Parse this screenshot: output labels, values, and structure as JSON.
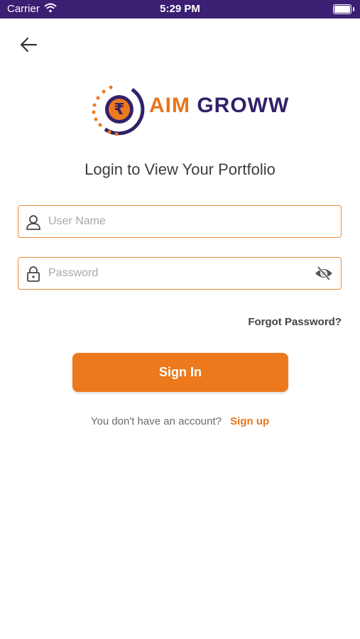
{
  "status_bar": {
    "carrier": "Carrier",
    "time": "5:29 PM"
  },
  "logo": {
    "word1": "AIM",
    "word2": "GROWW"
  },
  "title": "Login to View Your Portfolio",
  "username": {
    "placeholder": "User Name",
    "value": ""
  },
  "password": {
    "placeholder": "Password",
    "value": ""
  },
  "forgot_password": "Forgot Password?",
  "signin_button": "Sign In",
  "signup": {
    "question": "You don't have an account?",
    "link": "Sign up"
  },
  "colors": {
    "accent": "#ec7a1d",
    "brand_dark": "#32216b",
    "status_bar": "#3a1f73"
  },
  "icons": [
    "back-arrow-icon",
    "user-icon",
    "lock-icon",
    "eye-off-icon",
    "rupee-icon",
    "wifi-icon",
    "battery-icon"
  ]
}
